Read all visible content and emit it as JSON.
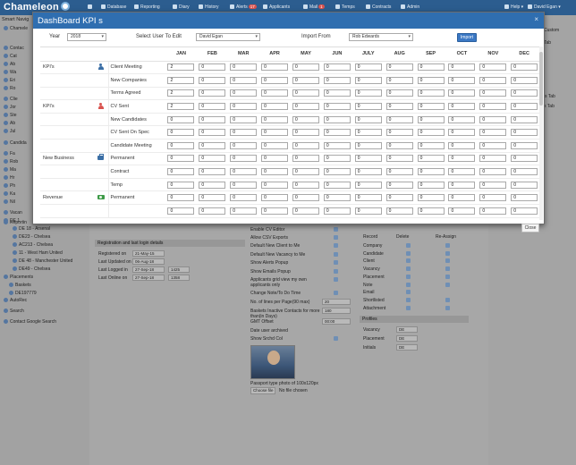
{
  "app": {
    "logo": "Chameleon"
  },
  "nav": {
    "items": [
      {
        "label": "Database",
        "icon": "database-icon"
      },
      {
        "label": "Reporting",
        "icon": "chart-icon"
      },
      {
        "label": "Diary",
        "icon": "calendar-icon"
      },
      {
        "label": "History",
        "icon": "history-icon"
      },
      {
        "label": "Alerts",
        "icon": "bell-icon",
        "badge": "17"
      },
      {
        "label": "Applicants",
        "icon": "users-icon"
      },
      {
        "label": "Mail",
        "icon": "mail-icon",
        "badge": "1"
      },
      {
        "label": "Temps",
        "icon": "clock-icon"
      },
      {
        "label": "Contracts",
        "icon": "document-icon"
      },
      {
        "label": "Admin",
        "icon": "gear-icon"
      }
    ],
    "help": "Help",
    "user": "David Egan"
  },
  "background": {
    "sidebar_title": "Smart Navig",
    "sidebar_items": [
      "Chamele",
      "Contac",
      "Cat",
      "Ab",
      "Wa",
      "Eri",
      "Ro",
      "Clie",
      "Jor",
      "Ste",
      "Ab",
      "Jul",
      "Candida",
      "Fa",
      "Rob",
      "Ma",
      "Hr",
      "Ph",
      "Ka",
      "Nil",
      "Vacan",
      "DE 1",
      "Reportin",
      "DE 18 - Arsenal",
      "DE23 - Chelsea",
      "AC213 - Chelsea",
      "11 - West Ham United",
      "DE 48 - Manchester United",
      "DE49 - Chelsea",
      "Placements",
      "Baskets",
      "DE197779",
      "AutoRec",
      "Search",
      "Contact Google Search"
    ],
    "reg_section_title": "Registration and last login details",
    "reg_rows": [
      {
        "label": "Registered on",
        "value": "21-May-15"
      },
      {
        "label": "Last Updated on",
        "value": "06-Aug-18"
      },
      {
        "label": "Last Logged in",
        "value": "27-Sep-18",
        "extra": "1425"
      },
      {
        "label": "Last Online on",
        "value": "27-Sep-18",
        "extra": "1358"
      }
    ],
    "settings": [
      "Enable CV Editor",
      "Allow CSV Exports",
      "Default New Client to Me",
      "Default New Vacancy to Me",
      "Show Alerts Popup",
      "Show Emails Popup",
      "Applicants grid view my own applicants only",
      "Change Note/To Do Time",
      "No. of lines per Page(90 max)",
      "Baskets Inactive Contacts for more than(in Days)",
      "GMT Offset",
      "Date user archived",
      "Show Srchd Col"
    ],
    "settings_values": {
      "lines_per_page": "20",
      "baskets_days": "180",
      "gmt": "00:00"
    },
    "passport_text": "Passport type photo of 100x120px",
    "choose_file": "Choose file",
    "no_file": "No file chosen",
    "record_headers": [
      "Record",
      "Delete",
      "Re-Assign"
    ],
    "records": [
      "Company",
      "Candidate",
      "Client",
      "Vacancy",
      "Placement",
      "Note",
      "Email",
      "Shortlisted",
      "Attachment"
    ],
    "profiles_title": "Profiles",
    "profiles": [
      {
        "label": "Vacancy",
        "value": "DE"
      },
      {
        "label": "Placement",
        "value": "DE"
      },
      {
        "label": "Initials",
        "value": "DE"
      }
    ],
    "right_col": [
      "Custom",
      "Tab",
      "'s Tab",
      "s Tab"
    ]
  },
  "modal": {
    "title": "DashBoard KPI s",
    "year_label": "Year",
    "year_value": "2018",
    "user_label": "Select User To Edit",
    "user_value": "David Egan",
    "import_label": "Import From",
    "import_value": "Rob Edwards",
    "import_button": "Import",
    "close_button": "Close",
    "months": [
      "JAN",
      "FEB",
      "MAR",
      "APR",
      "MAY",
      "JUN",
      "JULY",
      "AUG",
      "SEP",
      "OCT",
      "NOV",
      "DEC"
    ],
    "rows": [
      {
        "category": "KPI's",
        "icon": "client-user-icon",
        "icon_color": "#3a6ea5",
        "kpi": "Client Meeting",
        "values": [
          "2",
          "0",
          "0",
          "0",
          "0",
          "0",
          "0",
          "0",
          "0",
          "0",
          "0",
          "0"
        ]
      },
      {
        "category": "",
        "icon": "",
        "kpi": "New Companies",
        "values": [
          "2",
          "0",
          "0",
          "0",
          "0",
          "0",
          "0",
          "0",
          "0",
          "0",
          "0",
          "0"
        ]
      },
      {
        "category": "",
        "icon": "",
        "kpi": "Terms Agreed",
        "values": [
          "2",
          "0",
          "0",
          "0",
          "0",
          "0",
          "0",
          "0",
          "0",
          "0",
          "0",
          "0"
        ]
      },
      {
        "category": "KPI's",
        "icon": "candidate-user-icon",
        "icon_color": "#d9534f",
        "kpi": "CV Sent",
        "values": [
          "2",
          "0",
          "0",
          "0",
          "0",
          "0",
          "0",
          "0",
          "0",
          "0",
          "0",
          "0"
        ]
      },
      {
        "category": "",
        "icon": "",
        "kpi": "New Candidates",
        "values": [
          "0",
          "0",
          "0",
          "0",
          "0",
          "0",
          "0",
          "0",
          "0",
          "0",
          "0",
          "0"
        ]
      },
      {
        "category": "",
        "icon": "",
        "kpi": "CV Sent On Spec",
        "values": [
          "0",
          "0",
          "0",
          "0",
          "0",
          "0",
          "0",
          "0",
          "0",
          "0",
          "0",
          "0"
        ]
      },
      {
        "category": "",
        "icon": "",
        "kpi": "Candidate Meeting",
        "values": [
          "0",
          "0",
          "0",
          "0",
          "0",
          "0",
          "0",
          "0",
          "0",
          "0",
          "0",
          "0"
        ]
      },
      {
        "category": "New Business",
        "icon": "briefcase-icon",
        "kpi": "Permanent",
        "values": [
          "0",
          "0",
          "0",
          "0",
          "0",
          "0",
          "0",
          "0",
          "0",
          "0",
          "0",
          "0"
        ]
      },
      {
        "category": "",
        "icon": "",
        "kpi": "Contract",
        "values": [
          "0",
          "0",
          "0",
          "0",
          "0",
          "0",
          "0",
          "0",
          "0",
          "0",
          "0",
          "0"
        ]
      },
      {
        "category": "",
        "icon": "",
        "kpi": "Temp",
        "values": [
          "0",
          "0",
          "0",
          "0",
          "0",
          "0",
          "0",
          "0",
          "0",
          "0",
          "0",
          "0"
        ]
      },
      {
        "category": "Revenue",
        "icon": "money-icon",
        "kpi": "Permanent",
        "values": [
          "0",
          "0",
          "0",
          "0",
          "0",
          "0",
          "0",
          "0",
          "0",
          "0",
          "0",
          "0"
        ]
      },
      {
        "category": "",
        "icon": "",
        "kpi": "",
        "values": [
          "0",
          "0",
          "0",
          "0",
          "0",
          "0",
          "0",
          "0",
          "0",
          "0",
          "0",
          "0"
        ]
      }
    ]
  }
}
